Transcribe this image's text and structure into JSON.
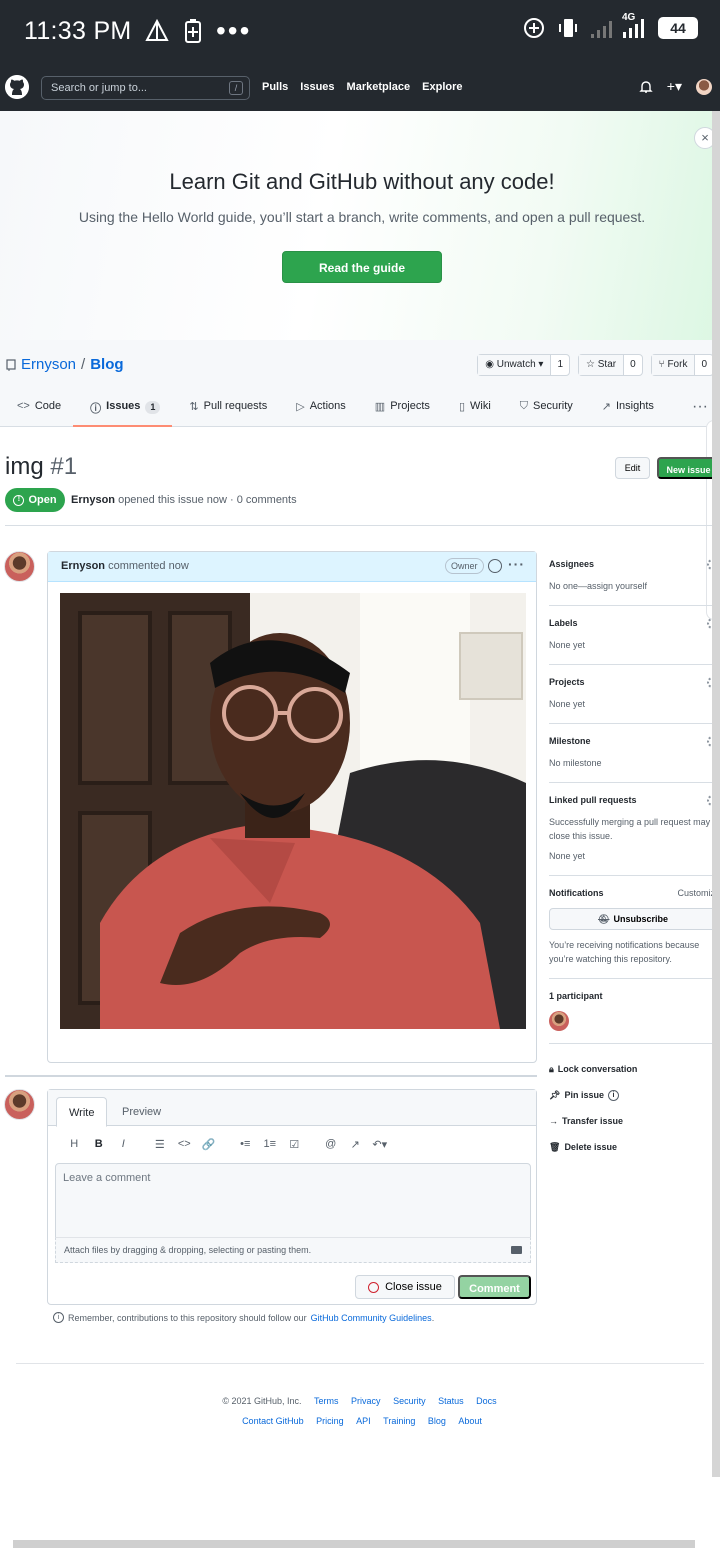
{
  "status_bar": {
    "time": "11:33 PM",
    "battery": "44",
    "network": "4G"
  },
  "header": {
    "search_placeholder": "Search or jump to...",
    "search_shortcut": "/",
    "nav": [
      "Pulls",
      "Issues",
      "Marketplace",
      "Explore"
    ],
    "plus": "+▾"
  },
  "banner": {
    "title": "Learn Git and GitHub without any code!",
    "subtitle": "Using the Hello World guide, you’ll start a branch, write comments, and open a pull request.",
    "button": "Read the guide",
    "close": "×"
  },
  "repo": {
    "owner": "Ernyson",
    "separator": "/",
    "name": "Blog",
    "actions": [
      {
        "label": "Unwatch ▾",
        "count": "1"
      },
      {
        "label": "Star",
        "count": "0"
      },
      {
        "label": "Fork",
        "count": "0"
      }
    ],
    "tabs": [
      {
        "icon": "<>",
        "label": "Code"
      },
      {
        "icon": "ⓘ",
        "label": "Issues",
        "count": "1"
      },
      {
        "icon": "⇅",
        "label": "Pull requests"
      },
      {
        "icon": "▷",
        "label": "Actions"
      },
      {
        "icon": "▥",
        "label": "Projects"
      },
      {
        "icon": "▯",
        "label": "Wiki"
      },
      {
        "icon": "⛉",
        "label": "Security"
      },
      {
        "icon": "↗",
        "label": "Insights"
      }
    ],
    "more": "···"
  },
  "issue": {
    "title": "img",
    "number": "#1",
    "edit": "Edit",
    "new_issue": "New issue",
    "state": "Open",
    "author": "Ernyson",
    "meta_text": " opened this issue now · 0 comments"
  },
  "comment": {
    "author": "Ernyson",
    "when": " commented now",
    "badge": "Owner",
    "menu": "···"
  },
  "form": {
    "tab_write": "Write",
    "tab_preview": "Preview",
    "toolbar": [
      "H",
      "B",
      "I",
      "☰",
      "<>",
      "🔗",
      "•≡",
      "1≡",
      "☑",
      "@",
      "↗",
      "↶▾"
    ],
    "placeholder": "Leave a comment",
    "attach": "Attach files by dragging & dropping, selecting or pasting them.",
    "close_issue": "Close issue",
    "comment_btn": "Comment",
    "guidelines_text": "Remember, contributions to this repository should follow our",
    "guidelines_link": "GitHub Community Guidelines",
    "guidelines_end": "."
  },
  "sidebar": {
    "assignees": {
      "title": "Assignees",
      "value": "No one—assign yourself"
    },
    "labels": {
      "title": "Labels",
      "value": "None yet"
    },
    "projects": {
      "title": "Projects",
      "value": "None yet"
    },
    "milestone": {
      "title": "Milestone",
      "value": "No milestone"
    },
    "linked": {
      "title": "Linked pull requests",
      "desc": "Successfully merging a pull request may close this issue.",
      "value": "None yet"
    },
    "notifications": {
      "title": "Notifications",
      "customize": "Customize",
      "button": "Unsubscribe",
      "desc": "You’re receiving notifications because you’re watching this repository."
    },
    "participants": {
      "title": "1 participant"
    },
    "actions": [
      "Lock conversation",
      "Pin issue",
      "Transfer issue",
      "Delete issue"
    ]
  },
  "footer": {
    "copyright": "© 2021 GitHub, Inc.",
    "row1": [
      "Terms",
      "Privacy",
      "Security",
      "Status",
      "Docs"
    ],
    "row2": [
      "Contact GitHub",
      "Pricing",
      "API",
      "Training",
      "Blog",
      "About"
    ]
  }
}
